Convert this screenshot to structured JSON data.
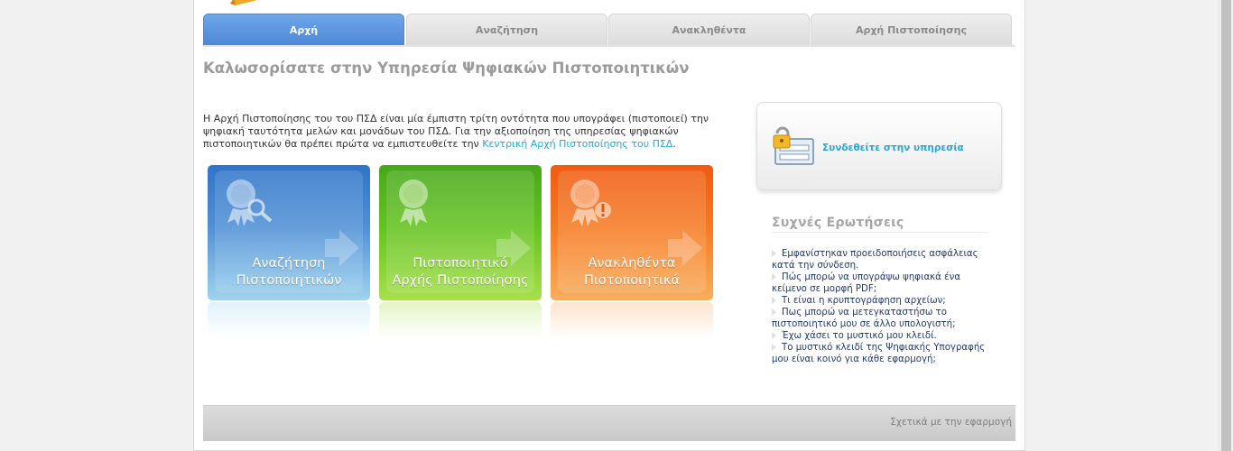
{
  "tabs": [
    {
      "label": "Αρχή",
      "active": true
    },
    {
      "label": "Αναζήτηση",
      "active": false
    },
    {
      "label": "Ανακληθέντα",
      "active": false
    },
    {
      "label": "Αρχή Πιστοποίησης",
      "active": false
    }
  ],
  "main": {
    "title": "Καλωσορίσατε στην Υπηρεσία Ψηφιακών Πιστοποιητικών",
    "intro_text": "Η Αρχή Πιστοποίησης του του ΠΣΔ είναι μία έμπιστη τρίτη οντότητα που υπογράφει (πιστοποιεί) την ψηφιακή ταυτότητα μελών και μονάδων του ΠΣΔ. Για την αξιοποίηση της υπηρεσίας ψηφιακών πιστοποιητικών θα πρέπει πρώτα να εμπιστευθείτε την ",
    "intro_link": "Κεντρική Αρχή Πιστοποίησης του ΠΣΔ",
    "intro_end": "."
  },
  "tiles": [
    {
      "line1": "Αναζήτηση",
      "line2": "Πιστοποιητικών",
      "color": "#3f84d2"
    },
    {
      "line1": "Πιστοποιητικό",
      "line2": "Αρχής Πιστοποίησης",
      "color": "#5fbd1e"
    },
    {
      "line1": "Ανακληθέντα",
      "line2": "Πιστοποιητικά",
      "color": "#f56f1c"
    }
  ],
  "login": {
    "link": "Συνδεθείτε στην υπηρεσία",
    "icon": "lock-form-icon"
  },
  "faq": {
    "title": "Συχνές Ερωτήσεις",
    "items": [
      {
        "l1": "Εμφανίστηκαν προειδοποιήσεις ασφάλειας",
        "l2": "κατά την σύνδεση."
      },
      {
        "l1": "Πώς μπορώ να υπογράψω ψηφιακά ένα",
        "l2": "κείμενο σε μορφή PDF;"
      },
      {
        "l1": "Τι είναι η κρυπτογράφηση αρχείων;",
        "l2": ""
      },
      {
        "l1": "Πως μπορώ να μετεγκαταστήσω το",
        "l2": "πιστοποιητικό μου σε άλλο υπολογιστή;"
      },
      {
        "l1": "Έχω χάσει το μυστικό μου κλειδί.",
        "l2": ""
      },
      {
        "l1": "Το μυστικό κλειδί της Ψηφιακής Υπογραφής",
        "l2": "μου είναι κοινό για κάθε εφαρμογή;"
      }
    ]
  },
  "footer": {
    "link": "Σχετικά με την εφαρμογή"
  },
  "colors": {
    "tab_active": "#5a93de",
    "link": "#2aa6d6",
    "faq_text": "#243b70"
  }
}
